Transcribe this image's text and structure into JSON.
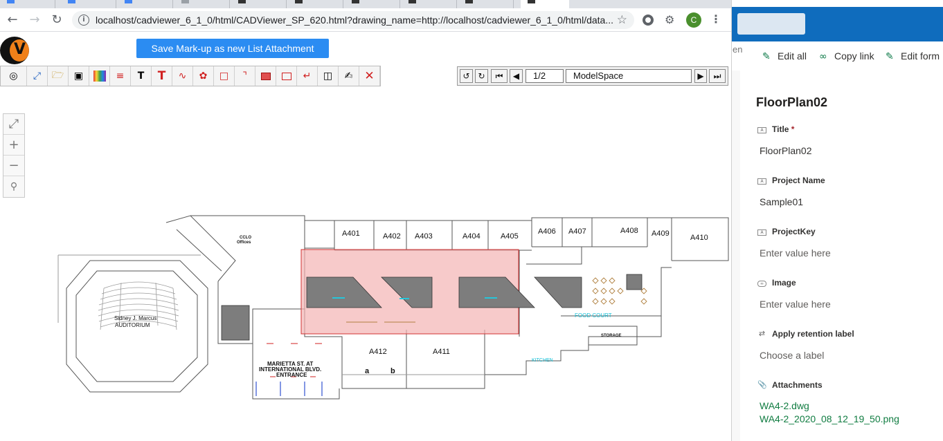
{
  "browser": {
    "url": "localhost/cadviewer_6_1_0/html/CADViewer_SP_620.html?drawing_name=http://localhost/cadviewer_6_1_0/html/data...",
    "profile_initial": "C"
  },
  "cadviewer": {
    "save_markup_label": "Save Mark-up as new List Attachment",
    "page_field": "1/2",
    "layout_field": "ModelSpace",
    "rooms": {
      "a401": "A401",
      "a402": "A402",
      "a403": "A403",
      "a404": "A404",
      "a405": "A405",
      "a406": "A406",
      "a407": "A407",
      "a408": "A408",
      "a409": "A409",
      "a410": "A410",
      "a411": "A411",
      "a412": "A412",
      "a": "a",
      "b": "b"
    },
    "labels": {
      "cclo_1": "CCLO",
      "cclo_2": "Offices",
      "auditorium_1": "Sidney J. Marcus",
      "auditorium_2": "AUDITORIUM",
      "entrance_1": "MARIETTA ST. AT",
      "entrance_2": "INTERNATIONAL BLVD.",
      "entrance_3": "ENTRANCE",
      "food_court": "FOOD COURT",
      "storage": "STORAGE",
      "kitchen": "KITCHEN"
    }
  },
  "sharepoint": {
    "edge_text": "en",
    "commands": {
      "edit_all": "Edit all",
      "copy_link": "Copy link",
      "edit_form": "Edit form"
    },
    "panel_title": "FloorPlan02",
    "fields": [
      {
        "label": "Title",
        "required_mark": "*",
        "value": "FloorPlan02"
      },
      {
        "label": "Project Name",
        "value": "Sample01"
      },
      {
        "label": "ProjectKey",
        "value": "Enter value here"
      },
      {
        "label": "Image",
        "value": "Enter value here"
      },
      {
        "label": "Apply retention label",
        "value": "Choose a label"
      },
      {
        "label": "Attachments"
      }
    ],
    "attachments": [
      "WA4-2.dwg",
      "WA4-2_2020_08_12_19_50.png"
    ]
  },
  "colors": {
    "accent_blue": "#2b8cf2",
    "suite_bar": "#0f6cbd",
    "markup_fill": "#f4b4b4",
    "link_green": "#107c41"
  },
  "icons": {
    "back": "arrow-left-icon",
    "forward": "arrow-right-icon",
    "reload": "reload-icon",
    "star": "star-icon",
    "puzzle": "extensions-icon"
  }
}
